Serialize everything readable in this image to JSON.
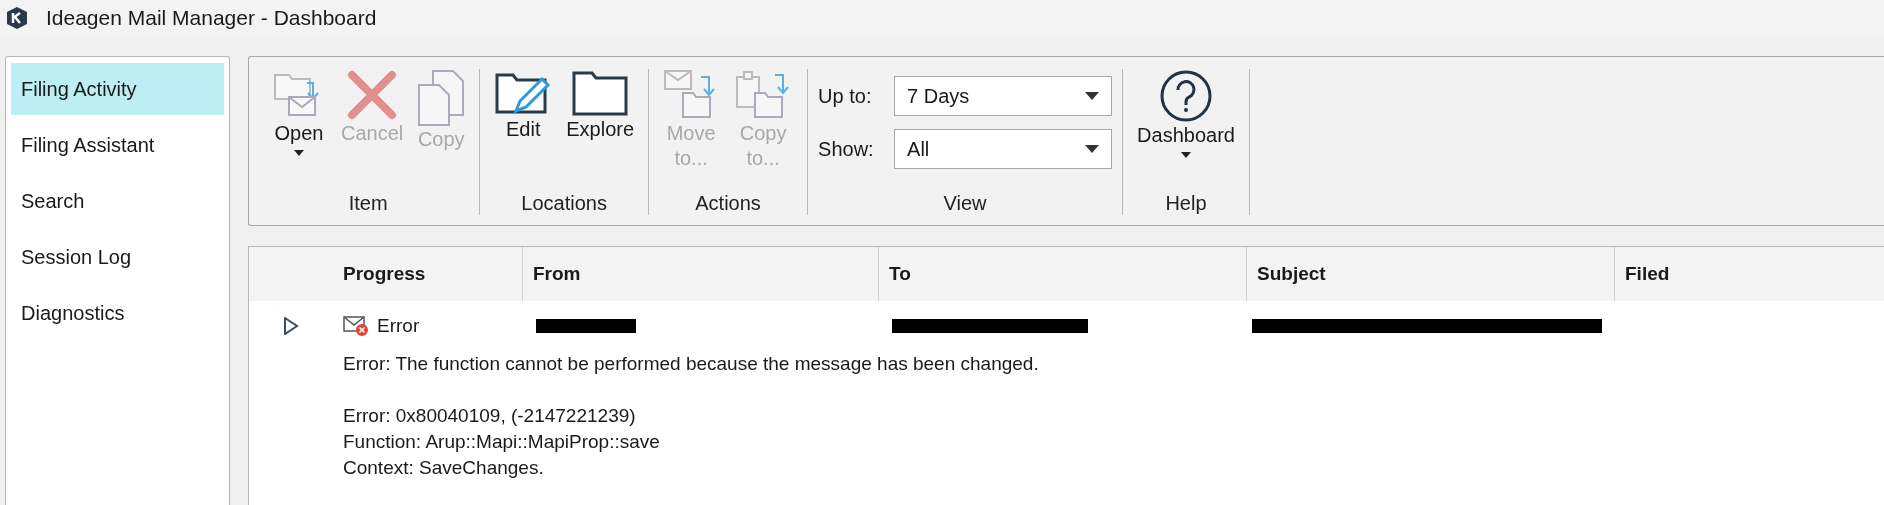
{
  "window": {
    "title": "Ideagen Mail Manager - Dashboard"
  },
  "sidebar": {
    "items": [
      {
        "label": "Filing Activity",
        "selected": true
      },
      {
        "label": "Filing Assistant",
        "selected": false
      },
      {
        "label": "Search",
        "selected": false
      },
      {
        "label": "Session Log",
        "selected": false
      },
      {
        "label": "Diagnostics",
        "selected": false
      }
    ]
  },
  "ribbon": {
    "groups": [
      {
        "label": "Item",
        "controls": [
          {
            "kind": "button",
            "label": "Open",
            "disabled": false,
            "dropdown": true
          },
          {
            "kind": "button",
            "label": "Cancel",
            "disabled": true,
            "dropdown": false
          },
          {
            "kind": "button",
            "label": "Copy",
            "disabled": true,
            "dropdown": false
          }
        ]
      },
      {
        "label": "Locations",
        "controls": [
          {
            "kind": "button",
            "label": "Edit",
            "disabled": false,
            "dropdown": false
          },
          {
            "kind": "button",
            "label": "Explore",
            "disabled": false,
            "dropdown": false
          }
        ]
      },
      {
        "label": "Actions",
        "controls": [
          {
            "kind": "button",
            "label": "Move to...",
            "disabled": true,
            "dropdown": false
          },
          {
            "kind": "button",
            "label": "Copy to...",
            "disabled": true,
            "dropdown": false
          }
        ]
      },
      {
        "label": "View",
        "controls": [
          {
            "kind": "select",
            "label": "Up to:",
            "value": "7 Days"
          },
          {
            "kind": "select",
            "label": "Show:",
            "value": "All"
          }
        ]
      },
      {
        "label": "Help",
        "controls": [
          {
            "kind": "button",
            "label": "Dashboard",
            "disabled": false,
            "dropdown": true
          }
        ]
      }
    ]
  },
  "table": {
    "columns": [
      "Progress",
      "From",
      "To",
      "Subject",
      "Filed"
    ],
    "rows": [
      {
        "expanded": false,
        "status": "Error",
        "from": {
          "redacted": true
        },
        "to": {
          "redacted": true
        },
        "subject": {
          "redacted": true
        },
        "message": "Error: The function cannot be performed because the message has been changed.",
        "details": [
          "Error: 0x80040109, (-2147221239)",
          "Function: Arup::Mapi::MapiProp::save",
          "Context: SaveChanges."
        ]
      }
    ]
  }
}
